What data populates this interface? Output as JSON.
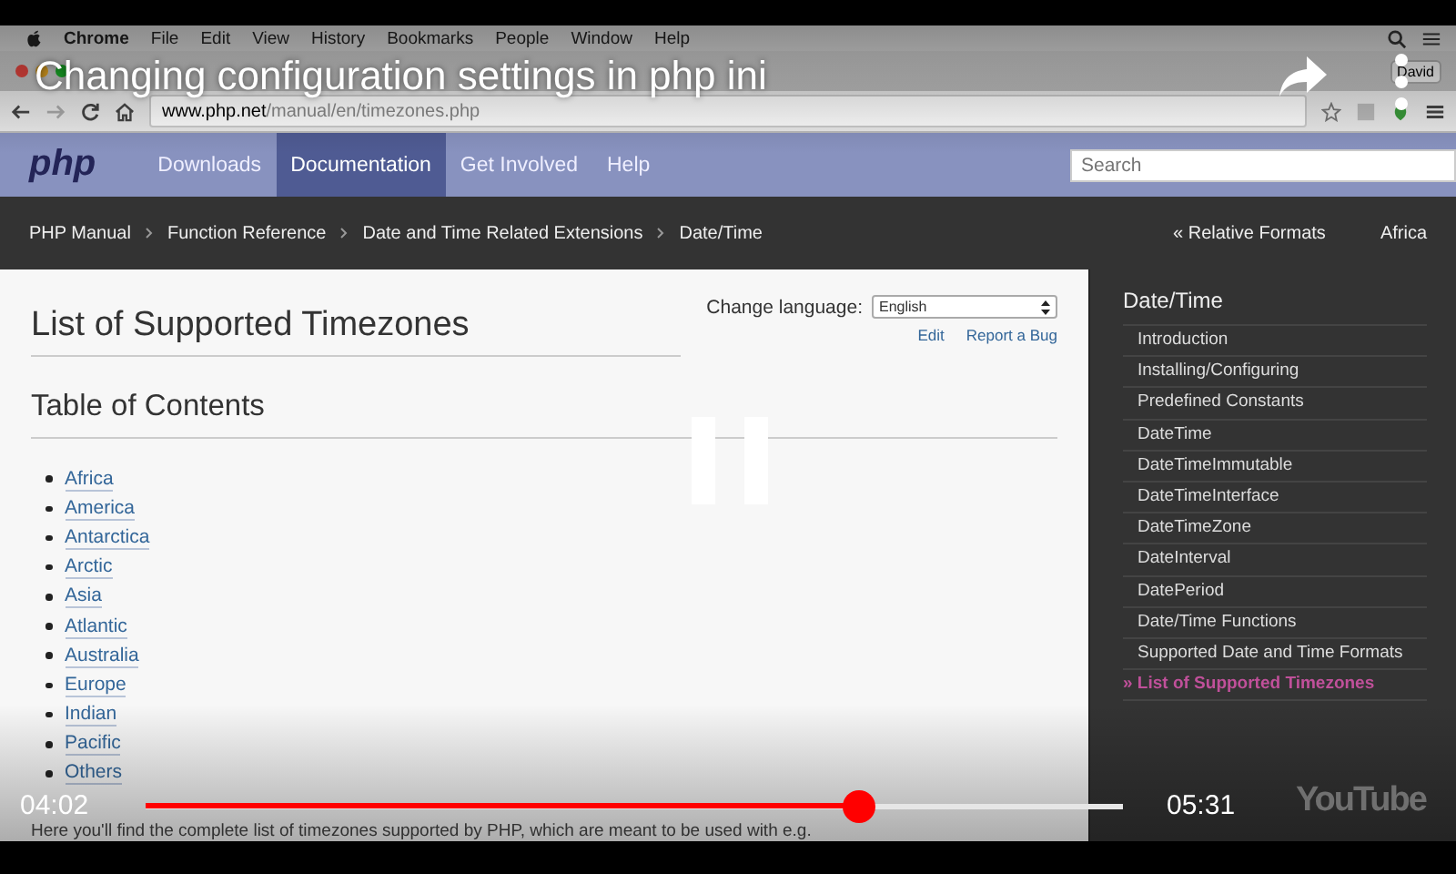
{
  "menubar": {
    "items": [
      "Chrome",
      "File",
      "Edit",
      "View",
      "History",
      "Bookmarks",
      "People",
      "Window",
      "Help"
    ]
  },
  "browser": {
    "profile": "David",
    "url_host": "www.php.net",
    "url_path": "/manual/en/timezones.php"
  },
  "site_nav": {
    "logo": "php",
    "items": [
      {
        "label": "Downloads",
        "selected": false
      },
      {
        "label": "Documentation",
        "selected": true
      },
      {
        "label": "Get Involved",
        "selected": false
      },
      {
        "label": "Help",
        "selected": false
      }
    ],
    "search": {
      "placeholder": "Search"
    }
  },
  "breadcrumbs": [
    "PHP Manual",
    "Function Reference",
    "Date and Time Related Extensions",
    "Date/Time"
  ],
  "pager": {
    "prev": "« Relative Formats",
    "next": "Africa"
  },
  "page": {
    "title": "List of Supported Timezones",
    "language_label": "Change language:",
    "language": "English",
    "links": [
      "Edit",
      "Report a Bug"
    ],
    "toc_heading": "Table of Contents",
    "toc": [
      "Africa",
      "America",
      "Antarctica",
      "Arctic",
      "Asia",
      "Atlantic",
      "Australia",
      "Europe",
      "Indian",
      "Pacific",
      "Others"
    ],
    "intro": "Here you'll find the complete list of timezones supported by PHP, which are meant to be used with e.g."
  },
  "sidebar": {
    "heading": "Date/Time",
    "items": [
      {
        "label": "Introduction",
        "selected": false
      },
      {
        "label": "Installing/Configuring",
        "selected": false
      },
      {
        "label": "Predefined Constants",
        "selected": false
      },
      {
        "label": "DateTime",
        "selected": false
      },
      {
        "label": "DateTimeImmutable",
        "selected": false
      },
      {
        "label": "DateTimeInterface",
        "selected": false
      },
      {
        "label": "DateTimeZone",
        "selected": false
      },
      {
        "label": "DateInterval",
        "selected": false
      },
      {
        "label": "DatePeriod",
        "selected": false
      },
      {
        "label": "Date/Time Functions",
        "selected": false
      },
      {
        "label": "Supported Date and Time Formats",
        "selected": false
      },
      {
        "label": "» List of Supported Timezones",
        "selected": true
      }
    ]
  },
  "player": {
    "title": "Changing configuration settings in php ini",
    "playing": true,
    "current_time": "04:02",
    "duration": "05:31",
    "progress": {
      "level": 0.73
    },
    "logo": "YouTube"
  }
}
